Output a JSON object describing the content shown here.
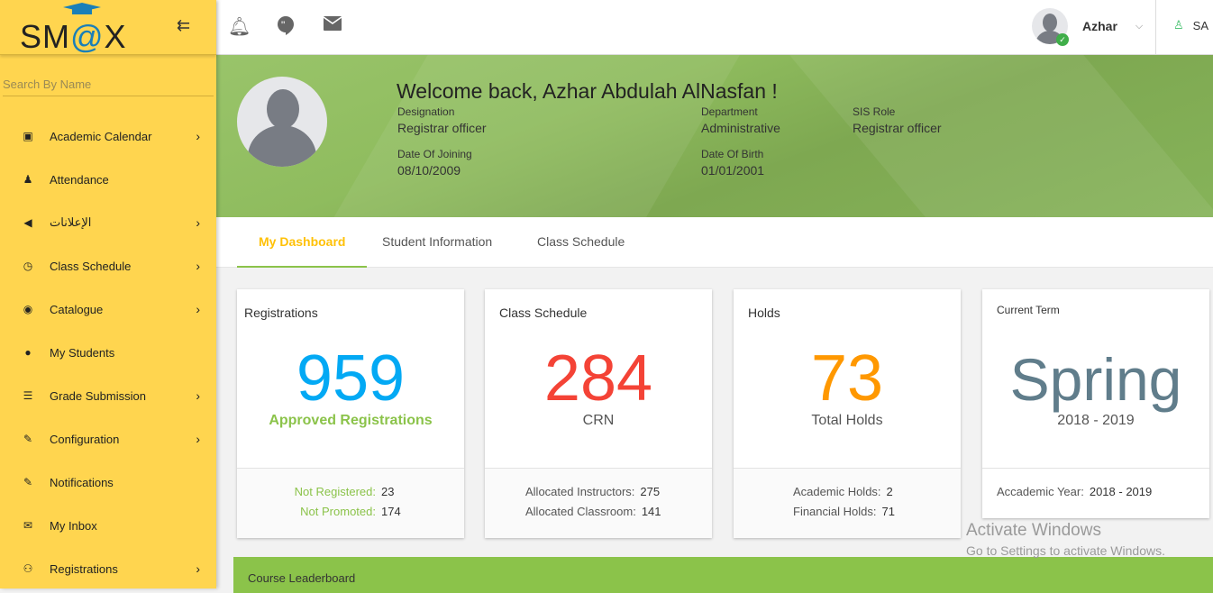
{
  "sidebar": {
    "logo": "SM@X",
    "search_placeholder": "Search By Name",
    "items": [
      {
        "label": "Academic Calendar",
        "icon": "calendar-icon",
        "chev": true
      },
      {
        "label": "Attendance",
        "icon": "person-icon",
        "chev": false
      },
      {
        "label": "الإعلانات",
        "icon": "megaphone-icon",
        "chev": true
      },
      {
        "label": "Class Schedule",
        "icon": "schedule-icon",
        "chev": true
      },
      {
        "label": "Catalogue",
        "icon": "disc-icon",
        "chev": true
      },
      {
        "label": "My Students",
        "icon": "account-icon",
        "chev": false
      },
      {
        "label": "Grade Submission",
        "icon": "list-icon",
        "chev": true
      },
      {
        "label": "Configuration",
        "icon": "config-icon",
        "chev": true
      },
      {
        "label": "Notifications",
        "icon": "notification-icon",
        "chev": false
      },
      {
        "label": "My Inbox",
        "icon": "mail-icon",
        "chev": false
      },
      {
        "label": "Registrations",
        "icon": "people-icon",
        "chev": true
      }
    ]
  },
  "topbar": {
    "user": "Azhar",
    "language": "SA"
  },
  "profile": {
    "welcome": "Welcome back, Azhar Abdulah AlNasfan !",
    "designation_label": "Designation",
    "designation": "Registrar officer",
    "department_label": "Department",
    "department": "Administrative",
    "role_label": "SIS Role",
    "role": "Registrar officer",
    "doj_label": "Date Of Joining",
    "doj": "08/10/2009",
    "dob_label": "Date Of Birth",
    "dob": "01/01/2001"
  },
  "tabs": [
    "My Dashboard",
    "Student Information",
    "Class Schedule"
  ],
  "cards": {
    "registrations": {
      "title": "Registrations",
      "value": "959",
      "sub": "Approved Registrations",
      "r1l": "Not Registered:",
      "r1v": "23",
      "r2l": "Not Promoted:",
      "r2v": "174"
    },
    "schedule": {
      "title": "Class Schedule",
      "value": "284",
      "sub": "CRN",
      "r1l": "Allocated Instructors:",
      "r1v": "275",
      "r2l": "Allocated Classroom:",
      "r2v": "141"
    },
    "holds": {
      "title": "Holds",
      "value": "73",
      "sub": "Total Holds",
      "r1l": "Academic Holds:",
      "r1v": "2",
      "r2l": "Financial Holds:",
      "r2v": "71"
    },
    "term": {
      "title": "Current Term",
      "value": "Spring",
      "sub": "2018 - 2019",
      "r1l": "Accademic Year:",
      "r1v": "2018 - 2019"
    }
  },
  "leaderboard": "Course Leaderboard",
  "watermark": {
    "title": "Activate Windows",
    "sub": "Go to Settings to activate Windows."
  },
  "colors": {
    "sidebar": "#FFD54F",
    "green": "#8BC34A",
    "blue": "#03A9F4",
    "red": "#F44336",
    "orange": "#FF9800",
    "slate": "#607D8B"
  }
}
